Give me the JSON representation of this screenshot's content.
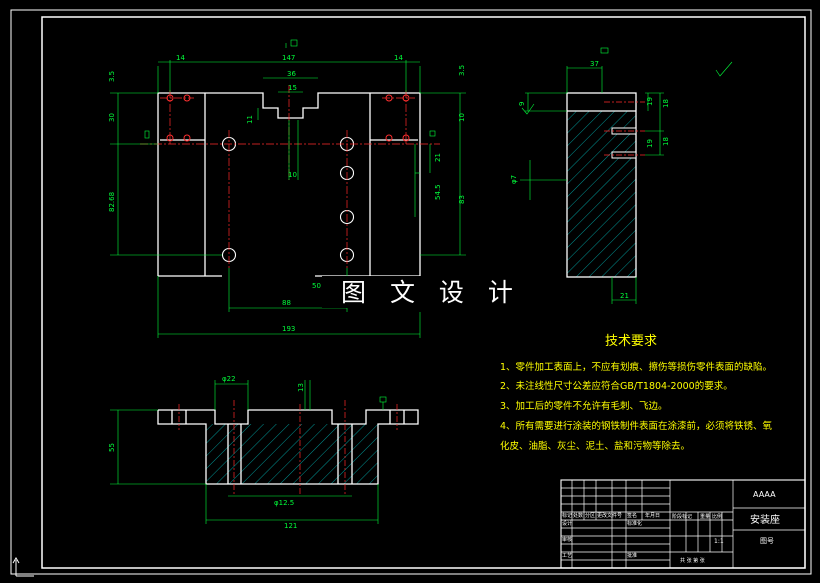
{
  "watermark": "图 文 设 计",
  "notes": {
    "title": "技术要求",
    "lines": [
      "1、零件加工表面上，不应有划痕、擦伤等损伤零件表面的缺陷。",
      "2、未注线性尺寸公差应符合GB/T1804-2000的要求。",
      "3、加工后的零件不允许有毛刺、飞边。",
      "4、所有需要进行涂装的钢铁制件表面在涂漆前，必须将铁锈、氧",
      "化皮、油脂、灰尘、泥土、盐和污物等除去。"
    ]
  },
  "title_block": {
    "code": "AAAA",
    "part_name": "安装座",
    "drawing_no_label": "图号",
    "scale": "1:1",
    "small_labels": [
      "标记",
      "处数",
      "分区",
      "更改文件号",
      "签名",
      "年月日",
      "设计",
      "标准化",
      "阶段标记",
      "重量",
      "比例",
      "审核",
      "工艺",
      "批准",
      "共 张 第 张"
    ]
  },
  "views": {
    "front": {
      "dims": {
        "d14_left": "14",
        "d147": "147",
        "d14_right": "14",
        "d36": "36",
        "d15": "15",
        "d3_5_left": "3.5",
        "d3_5_right": "3.5",
        "d30_left": "30",
        "d10_right": "10",
        "d11": "11",
        "d10_center": "10",
        "d82_68": "82.68",
        "d21": "21",
        "d54_5": "54.5",
        "d83": "83",
        "d88": "88",
        "d193": "193",
        "d50": "50"
      }
    },
    "side": {
      "dims": {
        "d37": "37",
        "d9": "9",
        "d18": "18",
        "d18b": "18",
        "d19": "19",
        "d19b": "19",
        "d7": "φ7",
        "d21": "21"
      }
    },
    "section": {
      "dims": {
        "phi22": "φ22",
        "d55": "55",
        "phi12_5": "φ12.5",
        "d121": "121",
        "d13": "13"
      }
    }
  },
  "colors": {
    "outline": "#ffffff",
    "dimension": "#00ff3a",
    "centerline": "#ff2a2a",
    "hatch": "#00c8c8",
    "border": "#ffffff",
    "note": "#ffff00"
  }
}
